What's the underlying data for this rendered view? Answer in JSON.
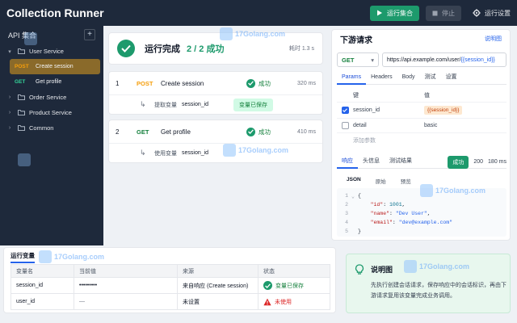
{
  "app": {
    "title": "Collection Runner"
  },
  "toolbar": {
    "run_label": "运行集合",
    "stop_label": "停止",
    "settings_label": "运行设置"
  },
  "sidebar": {
    "title": "API 集合",
    "add_label": "+",
    "groups": [
      {
        "label": "User Service",
        "expanded": true
      },
      {
        "label": "Order Service",
        "expanded": false
      },
      {
        "label": "Product Service",
        "expanded": false
      },
      {
        "label": "Common",
        "expanded": false
      }
    ],
    "requests": [
      {
        "method": "POST",
        "name": "Create session"
      },
      {
        "method": "GET",
        "name": "Get profile"
      }
    ]
  },
  "summary": {
    "title": "运行完成",
    "count": "2 / 2 成功",
    "duration": "耗时 1.3 s"
  },
  "runs": [
    {
      "index": "1",
      "method": "POST",
      "name": "Create session",
      "status": "成功",
      "time": "320 ms",
      "sub_label": "提取变量",
      "variable": "session_id",
      "chip": "变量已保存"
    },
    {
      "index": "2",
      "method": "GET",
      "name": "Get profile",
      "status": "成功",
      "time": "410 ms",
      "sub_label": "使用变量",
      "variable": "session_id"
    }
  ],
  "downstream": {
    "title": "下游请求",
    "doc_link": "说明图",
    "method": "GET",
    "url_prefix": "https://api.example.com/user/",
    "url_var": "{{session_id}}",
    "tabs": [
      "Params",
      "Headers",
      "Body",
      "测试",
      "设置"
    ],
    "params_header": {
      "key": "键",
      "value": "值"
    },
    "params": [
      {
        "checked": true,
        "key": "session_id",
        "value": "{{session_id}}"
      },
      {
        "checked": false,
        "key": "detail",
        "value": "basic"
      }
    ],
    "add_param": "添加参数",
    "response_tabs": [
      "响应",
      "头信息",
      "测试结果"
    ],
    "response_status": "成功",
    "response_code": "200",
    "response_time": "180 ms",
    "format_tabs": [
      "JSON",
      "原始",
      "预览"
    ],
    "body": {
      "open": "{",
      "id_key": "\"id\"",
      "id_val": "1001",
      "name_key": "\"name\"",
      "name_val": "\"Dev User\"",
      "email_key": "\"email\"",
      "email_val": "\"dev@example.com\"",
      "close": "}"
    }
  },
  "variables": {
    "tab": "运行变量",
    "headers": [
      "变量名",
      "当前值",
      "来源",
      "状态"
    ],
    "rows": [
      {
        "name": "session_id",
        "value": "•••••••••",
        "source": "来自响应 (Create session)",
        "status": "变量已保存",
        "ok": true
      },
      {
        "name": "user_id",
        "value": "—",
        "source": "未设置",
        "status": "未使用",
        "ok": false
      }
    ]
  },
  "note": {
    "title": "说明图",
    "body": "先执行创建会话请求，保存响应中的会话标识，再由下游请求复用该变量完成业务调用。"
  },
  "watermark": {
    "text": "17Golang.com"
  },
  "colors": {
    "accent_green": "#1d9a6c",
    "sidebar_bg": "#1e293b",
    "post": "#f59e0b",
    "get": "#34d399",
    "link_blue": "#2563eb"
  }
}
